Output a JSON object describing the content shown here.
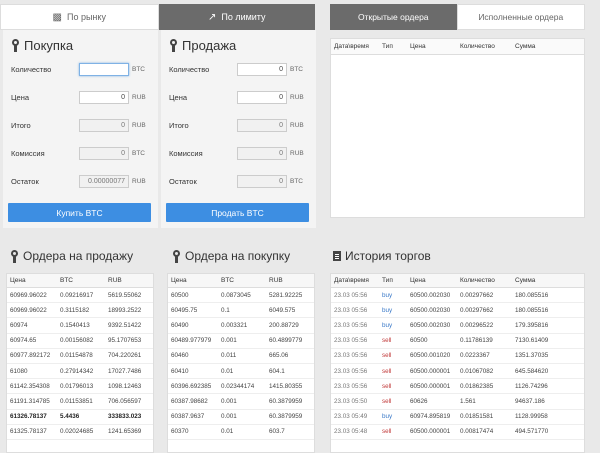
{
  "mode_tabs": [
    {
      "label": "По рынку",
      "icon": "bar-chart-icon",
      "active": false
    },
    {
      "label": "По лимиту",
      "icon": "arrow-up-right-icon",
      "active": true
    }
  ],
  "buy_form": {
    "title": "Покупка",
    "rows": [
      {
        "label": "Количество",
        "value": "",
        "unit": "BTC",
        "readonly": false,
        "focused": true
      },
      {
        "label": "Цена",
        "value": "0",
        "unit": "RUB",
        "readonly": false,
        "focused": false
      },
      {
        "label": "Итого",
        "value": "0",
        "unit": "RUB",
        "readonly": true,
        "focused": false
      },
      {
        "label": "Комиссия",
        "value": "0",
        "unit": "BTC",
        "readonly": true,
        "focused": false
      },
      {
        "label": "Остаток",
        "value": "0.00000077",
        "unit": "RUB",
        "readonly": true,
        "focused": false
      }
    ],
    "button": "Купить BTC"
  },
  "sell_form": {
    "title": "Продажа",
    "rows": [
      {
        "label": "Количество",
        "value": "0",
        "unit": "BTC",
        "readonly": false,
        "focused": false
      },
      {
        "label": "Цена",
        "value": "0",
        "unit": "RUB",
        "readonly": false,
        "focused": false
      },
      {
        "label": "Итого",
        "value": "0",
        "unit": "RUB",
        "readonly": true,
        "focused": false
      },
      {
        "label": "Комиссия",
        "value": "0",
        "unit": "RUB",
        "readonly": true,
        "focused": false
      },
      {
        "label": "Остаток",
        "value": "0",
        "unit": "BTC",
        "readonly": true,
        "focused": false
      }
    ],
    "button": "Продать BTC"
  },
  "orders_tabs": [
    {
      "label": "Открытые ордера",
      "active": true
    },
    {
      "label": "Исполненные ордера",
      "active": false
    }
  ],
  "open_orders_columns": [
    "Дата\\время",
    "Тип",
    "Цена",
    "Количество",
    "Сумма"
  ],
  "sell_orders": {
    "title": "Ордера на продажу",
    "columns": [
      "Цена",
      "BTC",
      "RUB"
    ],
    "rows": [
      [
        "60969.96022",
        "0.09216917",
        "5619.55062"
      ],
      [
        "60969.96022",
        "0.3115182",
        "18993.2522"
      ],
      [
        "60974",
        "0.1540413",
        "9392.51422"
      ],
      [
        "60974.65",
        "0.00156082",
        "95.1707653"
      ],
      [
        "60977.892172",
        "0.01154878",
        "704.220261"
      ],
      [
        "61080",
        "0.27914342",
        "17027.7486"
      ],
      [
        "61142.354308",
        "0.01796013",
        "1098.12463"
      ],
      [
        "61191.314785",
        "0.01153851",
        "706.056597"
      ],
      [
        "61326.78137",
        "5.4436",
        "333833.023"
      ],
      [
        "61325.78137",
        "0.02024685",
        "1241.65369"
      ]
    ],
    "bold_row": 8
  },
  "buy_orders": {
    "title": "Ордера на покупку",
    "columns": [
      "Цена",
      "BTC",
      "RUB"
    ],
    "rows": [
      [
        "60500",
        "0.0873045",
        "5281.92225"
      ],
      [
        "60495.75",
        "0.1",
        "6049.575"
      ],
      [
        "60490",
        "0.003321",
        "200.88729"
      ],
      [
        "60489.977979",
        "0.001",
        "60.4899779"
      ],
      [
        "60460",
        "0.011",
        "665.06"
      ],
      [
        "60410",
        "0.01",
        "604.1"
      ],
      [
        "60396.692385",
        "0.02344174",
        "1415.80355"
      ],
      [
        "60387.98682",
        "0.001",
        "60.3879959"
      ],
      [
        "60387.9637",
        "0.001",
        "60.3879959"
      ],
      [
        "60370",
        "0.01",
        "603.7"
      ]
    ]
  },
  "trade_history": {
    "title": "История торгов",
    "columns": [
      "Дата\\время",
      "Тип",
      "Цена",
      "Количество",
      "Сумма"
    ],
    "rows": [
      [
        "23.03 05:56",
        "buy",
        "60500.002030",
        "0.00297662",
        "180.085516"
      ],
      [
        "23.03 05:56",
        "buy",
        "60500.002030",
        "0.00297662",
        "180.085516"
      ],
      [
        "23.03 05:56",
        "buy",
        "60500.002030",
        "0.00296522",
        "179.395816"
      ],
      [
        "23.03 05:56",
        "sell",
        "60500",
        "0.11786139",
        "7130.61409"
      ],
      [
        "23.03 05:56",
        "sell",
        "60500.001020",
        "0.0223367",
        "1351.37035"
      ],
      [
        "23.03 05:56",
        "sell",
        "60500.000001",
        "0.01067082",
        "645.584620"
      ],
      [
        "23.03 05:56",
        "sell",
        "60500.000001",
        "0.01862385",
        "1126.74296"
      ],
      [
        "23.03 05:50",
        "sell",
        "60626",
        "1.561",
        "94637.186"
      ],
      [
        "23.03 05:49",
        "buy",
        "60974.895819",
        "0.01851581",
        "1128.99958"
      ],
      [
        "23.03 05:48",
        "sell",
        "60500.000001",
        "0.00817474",
        "494.571770"
      ]
    ]
  },
  "colors": {
    "accent": "#3d8ee2",
    "buy": "#3a79c8",
    "sell": "#c23a3a",
    "tab_active": "#6b6b6b"
  }
}
